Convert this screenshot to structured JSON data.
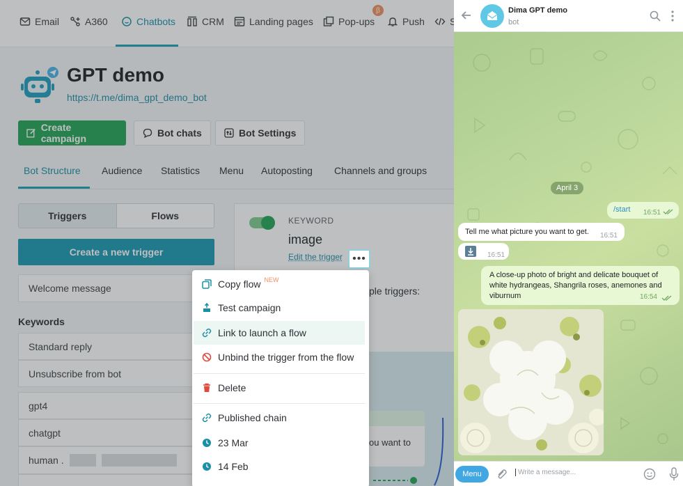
{
  "nav": {
    "items": [
      {
        "label": "Email",
        "icon": "mail-icon"
      },
      {
        "label": "A360",
        "icon": "automation-icon"
      },
      {
        "label": "Chatbots",
        "icon": "chatbot-icon"
      },
      {
        "label": "CRM",
        "icon": "crm-icon"
      },
      {
        "label": "Landing pages",
        "icon": "landing-page-icon"
      },
      {
        "label": "Pop-ups",
        "icon": "popup-icon"
      },
      {
        "label": "Push",
        "icon": "bell-icon"
      },
      {
        "label": "S",
        "icon": "code-icon"
      }
    ],
    "beta_badge": "β",
    "active": "Chatbots"
  },
  "bot": {
    "title": "GPT demo",
    "link": "https://t.me/dima_gpt_demo_bot"
  },
  "actions": {
    "create_campaign": "Create campaign",
    "bot_chats": "Bot chats",
    "bot_settings": "Bot Settings"
  },
  "tabs": [
    "Bot Structure",
    "Audience",
    "Statistics",
    "Menu",
    "Autoposting",
    "Channels and groups"
  ],
  "left": {
    "segments": [
      "Triggers",
      "Flows"
    ],
    "create_trigger": "Create a new trigger",
    "welcome": "Welcome message",
    "keywords_heading": "Keywords",
    "items": [
      "Standard reply",
      "Unsubscribe from bot",
      "gpt4",
      "chatgpt",
      "human ."
    ]
  },
  "trigger": {
    "type_label": "KEYWORD",
    "value": "image",
    "edit_link": "Edit the trigger",
    "more_button": "•••",
    "obscured_text": "ple triggers:",
    "obscured_text2": "ou want to"
  },
  "context_menu": {
    "items": [
      {
        "label": "Copy flow",
        "icon": "copy-icon",
        "badge": "NEW"
      },
      {
        "label": "Test campaign",
        "icon": "test-icon"
      },
      {
        "label": "Link to launch a flow",
        "icon": "link-icon",
        "highlighted": true
      },
      {
        "label": "Unbind the trigger from the flow",
        "icon": "unbind-icon"
      },
      {
        "label": "Delete",
        "icon": "trash-icon"
      },
      {
        "label": "Published chain",
        "icon": "chain-link-icon"
      },
      {
        "label": "23 Mar",
        "icon": "clock-icon"
      },
      {
        "label": "14 Feb",
        "icon": "clock-icon"
      }
    ]
  },
  "telegram": {
    "chat_name": "Dima GPT demo",
    "chat_subtitle": "bot",
    "date_divider": "April 3",
    "messages": [
      {
        "direction": "out",
        "text": "/start",
        "time": "16:51"
      },
      {
        "direction": "in",
        "text": "Tell me what picture you want to get.",
        "time": "16:51"
      },
      {
        "direction": "in",
        "text": "",
        "time": "16:51",
        "attachment": "download-icon"
      },
      {
        "direction": "out",
        "text": "A close-up photo of bright and delicate bouquet of white hydrangeas, Shangrila roses, anemones and viburnum",
        "time": "16:54"
      }
    ],
    "menu_button": "Menu",
    "input_placeholder": "Write a message..."
  },
  "colors": {
    "accent": "#1a98b3",
    "primary_green": "#23a455",
    "telegram_blue": "#40a7e3"
  }
}
